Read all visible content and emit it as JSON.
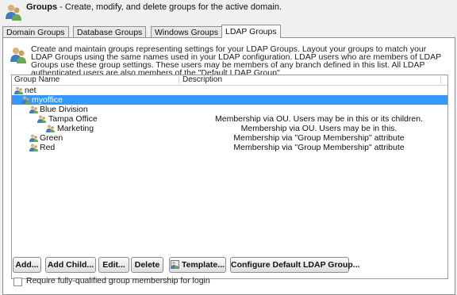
{
  "header": {
    "title": "Groups",
    "subtitle": " - Create, modify, and delete groups for the active domain."
  },
  "tabs": [
    {
      "label": "Domain Groups",
      "active": false
    },
    {
      "label": "Database Groups",
      "active": false
    },
    {
      "label": "Windows Groups",
      "active": false
    },
    {
      "label": "LDAP Groups",
      "active": true
    }
  ],
  "intro": "Create and maintain groups representing settings for your LDAP Groups. Layout your groups to match your LDAP Groups using the same names used in your LDAP configuration. LDAP users who are members of LDAP Groups use these group settings. These users may be members of any branch defined in this list. All LDAP authenticated users are also members of the \"Default LDAP Group\".",
  "table": {
    "columns": [
      "Group Name",
      "Description"
    ],
    "rows": [
      {
        "name": "net",
        "description": "",
        "level": 0,
        "selected": false
      },
      {
        "name": "myoffice",
        "description": "",
        "level": 1,
        "selected": true
      },
      {
        "name": "Blue Division",
        "description": "",
        "level": 2,
        "selected": false
      },
      {
        "name": "Tampa Office",
        "description": "Membership via OU. Users may be in this or its children.",
        "level": 3,
        "selected": false
      },
      {
        "name": "Marketing",
        "description": "Membership via OU. Users may be in this.",
        "level": 4,
        "selected": false
      },
      {
        "name": "Green",
        "description": "Membership via \"Group Membership\" attribute",
        "level": 2,
        "selected": false
      },
      {
        "name": "Red",
        "description": "Membership via \"Group Membership\" attribute",
        "level": 2,
        "selected": false
      }
    ]
  },
  "buttons": {
    "add": "Add...",
    "add_child": "Add Child...",
    "edit": "Edit...",
    "delete": "Delete",
    "template": "Template...",
    "configure": "Configure Default LDAP Group..."
  },
  "checkbox": {
    "label": "Require fully-qualified group membership for login",
    "checked": false
  },
  "colors": {
    "selection": "#3399ff",
    "icon_blue": "#3f7fc0",
    "icon_tan": "#c8a15a",
    "icon_green": "#6aa84f"
  },
  "icons": {
    "header": "users-group-icon",
    "intro": "users-group-icon",
    "row": "group-icon",
    "template": "group-template-icon"
  }
}
